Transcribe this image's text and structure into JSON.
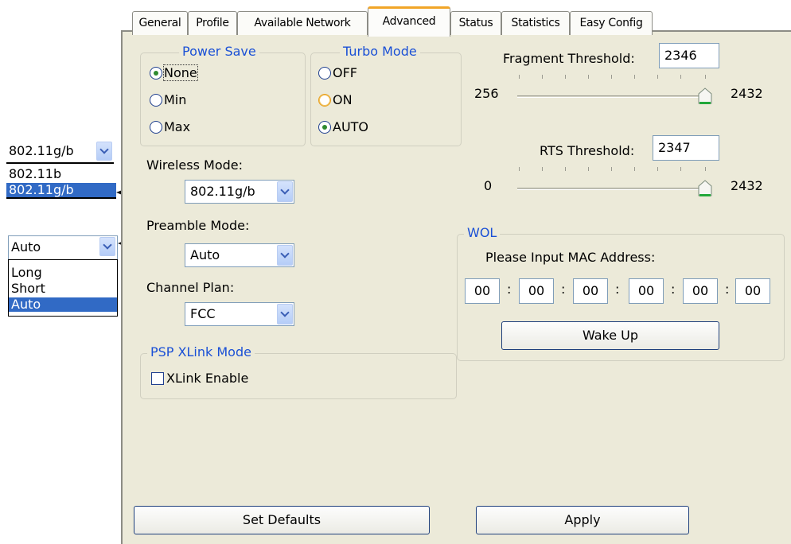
{
  "tabs": [
    "General",
    "Profile",
    "Available Network",
    "Advanced",
    "Status",
    "Statistics",
    "Easy Config"
  ],
  "power_save": {
    "title": "Power Save",
    "options": [
      "None",
      "Min",
      "Max"
    ],
    "selected": "None"
  },
  "turbo_mode": {
    "title": "Turbo Mode",
    "options": [
      "OFF",
      "ON",
      "AUTO"
    ],
    "selected": "AUTO"
  },
  "wireless_mode": {
    "label": "Wireless Mode:",
    "value": "802.11g/b"
  },
  "preamble_mode": {
    "label": "Preamble Mode:",
    "value": "Auto"
  },
  "channel_plan": {
    "label": "Channel Plan:",
    "value": "FCC"
  },
  "psp_xlink": {
    "title": "PSP XLink Mode",
    "checkbox_label": "XLink Enable",
    "checked": false
  },
  "fragment": {
    "label": "Fragment Threshold:",
    "value": "2346",
    "min": "256",
    "max": "2432",
    "level": 1.0
  },
  "rts": {
    "label": "RTS Threshold:",
    "value": "2347",
    "min": "0",
    "max": "2432",
    "level": 1.0
  },
  "wol": {
    "title": "WOL",
    "prompt": "Please Input MAC Address:",
    "mac": [
      "00",
      "00",
      "00",
      "00",
      "00",
      "00"
    ],
    "separator": ":",
    "button": "Wake Up"
  },
  "buttons": {
    "set_defaults": "Set Defaults",
    "apply": "Apply"
  },
  "example_wireless_dropdown": {
    "value": "802.11g/b",
    "options": [
      "802.11b",
      "802.11g/b"
    ],
    "highlighted": "802.11g/b"
  },
  "example_preamble_dropdown": {
    "value": "Auto",
    "options": [
      "Long",
      "Short",
      "Auto"
    ],
    "highlighted": "Auto"
  },
  "colors": {
    "panel": "#ECEAD9",
    "legend": "#1A50D6",
    "selection": "#316AC5",
    "tab_accent": "#F1A527"
  }
}
